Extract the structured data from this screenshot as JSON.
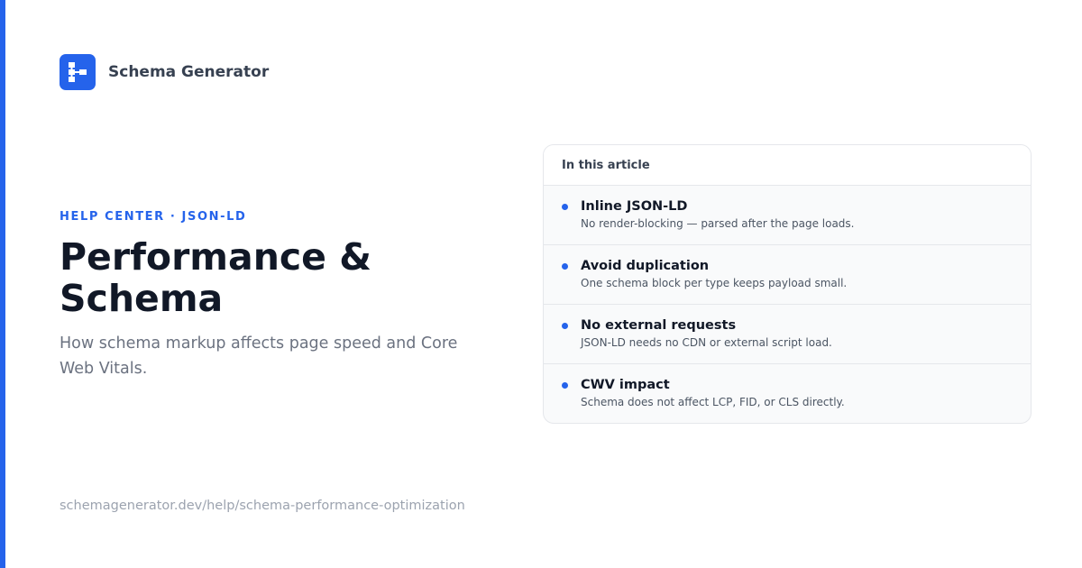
{
  "brand": {
    "name": "Schema Generator",
    "logo_icon": "sitemap-icon",
    "accent_color": "#2563eb"
  },
  "hero": {
    "eyebrow": "HELP CENTER · JSON-LD",
    "title": "Performance & Schema",
    "subtitle": "How schema markup affects page speed and Core Web Vitals."
  },
  "toc": {
    "heading": "In this article",
    "items": [
      {
        "title": "Inline JSON-LD",
        "description": "No render-blocking — parsed after the page loads."
      },
      {
        "title": "Avoid duplication",
        "description": "One schema block per type keeps payload small."
      },
      {
        "title": "No external requests",
        "description": "JSON-LD needs no CDN or external script load."
      },
      {
        "title": "CWV impact",
        "description": "Schema does not affect LCP, FID, or CLS directly."
      }
    ]
  },
  "footer": {
    "url": "schemagenerator.dev/help/schema-performance-optimization"
  }
}
